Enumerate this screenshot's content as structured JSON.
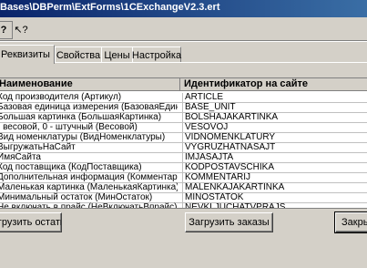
{
  "window": {
    "title": "Bases\\DBPerm\\ExtForms\\1CExchangeV2.3.ert"
  },
  "toolbar": {
    "help_glyph": "?",
    "cursor_glyph": "↖?"
  },
  "tabs": [
    {
      "label": "Реквизиты",
      "active": true
    },
    {
      "label": "Свойства",
      "active": false
    },
    {
      "label": "Цены",
      "active": false
    },
    {
      "label": "Настройка",
      "active": false
    }
  ],
  "table": {
    "columns": [
      "Наименование",
      "Идентификатор на сайте"
    ],
    "rows": [
      [
        "Код производителя (Артикул)",
        "ARTICLE"
      ],
      [
        "Базовая единица измерения (БазоваяЕдиница)",
        "BASE_UNIT"
      ],
      [
        "Большая картинка (БольшаяКартинка)",
        "BOLSHAJAKARTINKA"
      ],
      [
        "- весовой, 0 - штучный (Весовой)",
        "VESOVOJ"
      ],
      [
        "Вид номенклатуры (ВидНоменклатуры)",
        "VIDNOMENKLATURY"
      ],
      [
        "ВыгружатьНаСайт",
        "VYGRUZHATNASAJT"
      ],
      [
        "ИмяСайта",
        "IMJASAJTA"
      ],
      [
        "Код поставщика (КодПоставщика)",
        "KODPOSTAVSCHIKA"
      ],
      [
        "Дополнительная информация (Комментарий)",
        "KOMMENTARIJ"
      ],
      [
        "Маленькая картинка (МаленькаяКартинка)",
        "MALENKAJAKARTINKA"
      ],
      [
        "Минимальный остаток (МинОстаток)",
        "MINOSTATOK"
      ],
      [
        "Не включать в прайс (НеВключатьВпрайс)",
        "NEVKLJUCHATVPRAJS"
      ]
    ]
  },
  "buttons": {
    "load_stock": "Загрузить остатки",
    "load_orders": "Загрузить заказы",
    "close": "Закрыть"
  }
}
